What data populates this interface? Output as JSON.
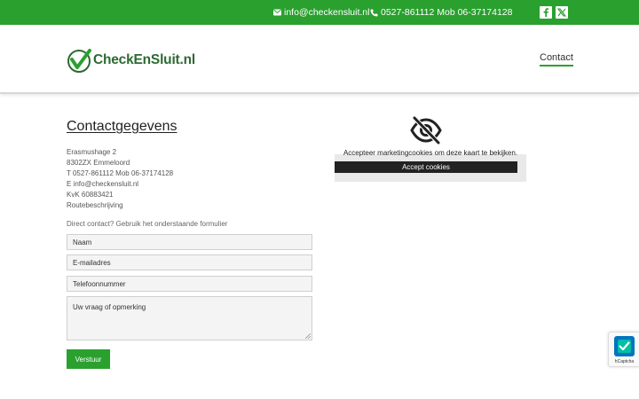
{
  "topbar": {
    "email": "info@checkensluit.nl",
    "phone": "0527-861112 Mob 06-37174128",
    "social": [
      {
        "icon": "facebook-icon"
      },
      {
        "icon": "x-twitter-icon"
      }
    ]
  },
  "header": {
    "logo_text": "CheckEnSluit.nl",
    "nav": [
      {
        "label": "Contact",
        "active": true
      }
    ]
  },
  "contact": {
    "title": "Contactgegevens",
    "street": "Erasmushage 2",
    "city": "8302ZX Emmeloord",
    "phone_prefix": "T",
    "phone": "0527-861112 Mob 06-37174128",
    "email_prefix": "E",
    "email": "info@checkensluit.nl",
    "kvk": "KvK 60883421",
    "route": "Routebeschrijving"
  },
  "form": {
    "intro": "Direct contact? Gebruik het onderstaande formulier",
    "name_placeholder": "Naam",
    "email_placeholder": "E-mailadres",
    "phone_placeholder": "Telefoonnummer",
    "message_placeholder": "Uw vraag of opmerking",
    "submit_label": "Verstuur"
  },
  "map": {
    "icon": "eye-slash-icon",
    "message": "Accepteer marketingcookies om deze kaart te bekijken.",
    "button_label": "Accept cookies"
  },
  "captcha": {
    "label": "hCaptcha"
  },
  "colors": {
    "accent": "#2aa02f",
    "dark": "#222222",
    "logo_text": "#2d6a32"
  }
}
